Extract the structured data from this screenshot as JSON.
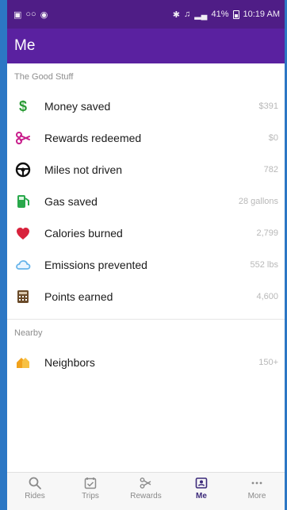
{
  "status_bar": {
    "right_text": "41%",
    "time": "10:19 AM"
  },
  "app_bar": {
    "title": "Me"
  },
  "sections": [
    {
      "title": "The Good Stuff",
      "items": [
        {
          "label": "Money saved",
          "value": "$391",
          "icon": "money-icon"
        },
        {
          "label": "Rewards redeemed",
          "value": "$0",
          "icon": "rewards-redeemed-icon"
        },
        {
          "label": "Miles not driven",
          "value": "782",
          "icon": "steering-wheel-icon"
        },
        {
          "label": "Gas saved",
          "value": "28 gallons",
          "icon": "gas-pump-icon"
        },
        {
          "label": "Calories burned",
          "value": "2,799",
          "icon": "heart-icon"
        },
        {
          "label": "Emissions prevented",
          "value": "552 lbs",
          "icon": "cloud-icon"
        },
        {
          "label": "Points earned",
          "value": "4,600",
          "icon": "calculator-icon"
        }
      ]
    },
    {
      "title": "Nearby",
      "items": [
        {
          "label": "Neighbors",
          "value": "150+",
          "icon": "neighbors-icon"
        }
      ]
    }
  ],
  "bottom_nav": [
    {
      "label": "Rides",
      "icon": "search-icon",
      "active": false
    },
    {
      "label": "Trips",
      "icon": "calendar-check-icon",
      "active": false
    },
    {
      "label": "Rewards",
      "icon": "scissors-icon",
      "active": false
    },
    {
      "label": "Me",
      "icon": "profile-card-icon",
      "active": true
    },
    {
      "label": "More",
      "icon": "more-icon",
      "active": false
    }
  ],
  "colors": {
    "status_bar": "#4f1d86",
    "app_bar": "#5a21a0",
    "accent_green": "#2a9b35",
    "accent_red": "#d8223c",
    "accent_orange": "#f1a21c",
    "nav_active": "#3c2a7a"
  }
}
